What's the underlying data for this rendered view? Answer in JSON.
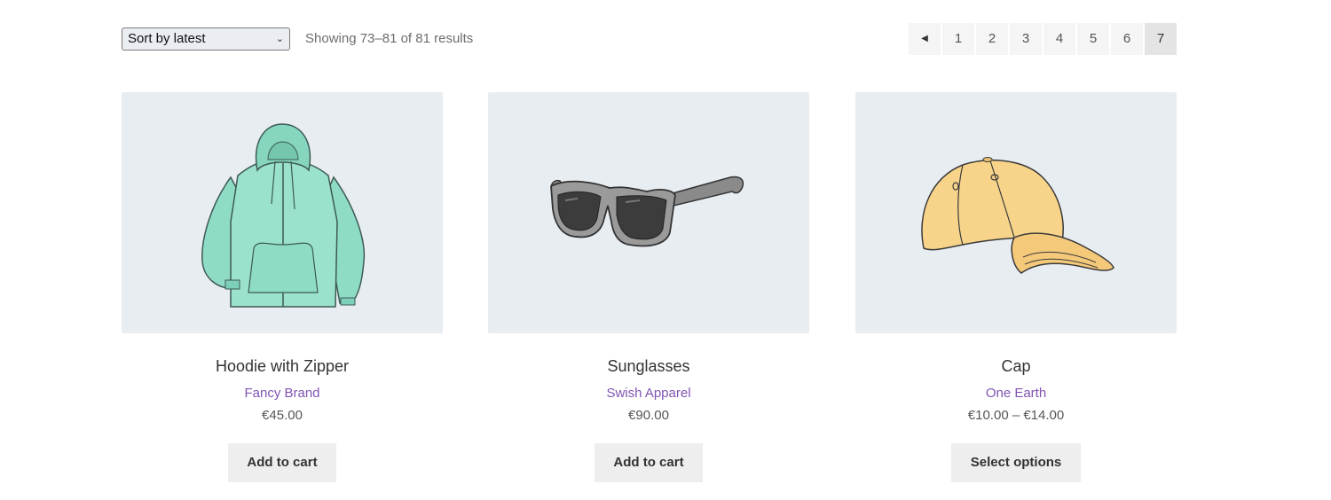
{
  "sort": {
    "selected": "Sort by latest"
  },
  "result_count": "Showing 73–81 of 81 results",
  "pagination": {
    "prev_icon": "triangle-left-icon",
    "pages": [
      "1",
      "2",
      "3",
      "4",
      "5",
      "6",
      "7"
    ],
    "current": "7"
  },
  "products": [
    {
      "title": "Hoodie with Zipper",
      "brand": "Fancy Brand",
      "price": "€45.00",
      "button": "Add to cart",
      "image": "hoodie-image"
    },
    {
      "title": "Sunglasses",
      "brand": "Swish Apparel",
      "price": "€90.00",
      "button": "Add to cart",
      "image": "sunglasses-image"
    },
    {
      "title": "Cap",
      "brand": "One Earth",
      "price": "€10.00 – €14.00",
      "button": "Select options",
      "image": "cap-image"
    }
  ],
  "colors": {
    "brand_link": "#7f54b3",
    "thumb_bg": "#e8edf2",
    "button_bg": "#eeeeee"
  }
}
